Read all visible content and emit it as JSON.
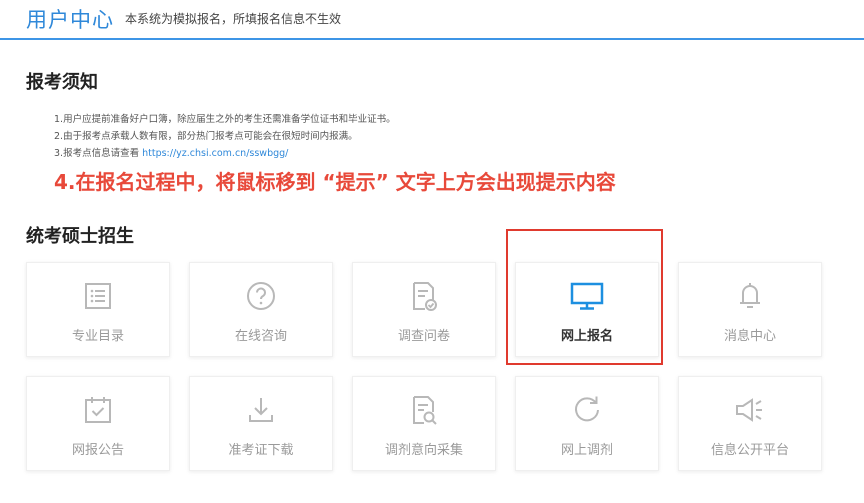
{
  "header": {
    "brand": "用户中心",
    "subtitle": "本系统为模拟报名，所填报名信息不生效"
  },
  "notice": {
    "title": "报考须知",
    "lines": [
      "1.用户应提前准备好户口簿，除应届生之外的考生还需准备学位证书和毕业证书。",
      "2.由于报考点承载人数有限，部分热门报考点可能会在很短时间内报满。"
    ],
    "line3_prefix": "3.报考点信息请查看",
    "line3_link": "https://yz.chsi.com.cn/sswbgg/",
    "highlight": "4.在报名过程中，将鼠标移到 “提示” 文字上方会出现提示内容"
  },
  "exam": {
    "title": "统考硕士招生",
    "cards": [
      {
        "label": "专业目录",
        "icon": "list-icon"
      },
      {
        "label": "在线咨询",
        "icon": "question-icon"
      },
      {
        "label": "调查问卷",
        "icon": "survey-icon"
      },
      {
        "label": "网上报名",
        "icon": "monitor-icon",
        "active": true
      },
      {
        "label": "消息中心",
        "icon": "bell-icon"
      },
      {
        "label": "网报公告",
        "icon": "calendar-icon"
      },
      {
        "label": "准考证下载",
        "icon": "download-icon"
      },
      {
        "label": "调剂意向采集",
        "icon": "search-doc-icon"
      },
      {
        "label": "网上调剂",
        "icon": "refresh-icon"
      },
      {
        "label": "信息公开平台",
        "icon": "megaphone-icon"
      }
    ]
  },
  "colors": {
    "brand": "#2f88d9",
    "highlight": "#e8493a",
    "icon_inactive": "#b8b8b8",
    "icon_active": "#1d8fe0"
  }
}
